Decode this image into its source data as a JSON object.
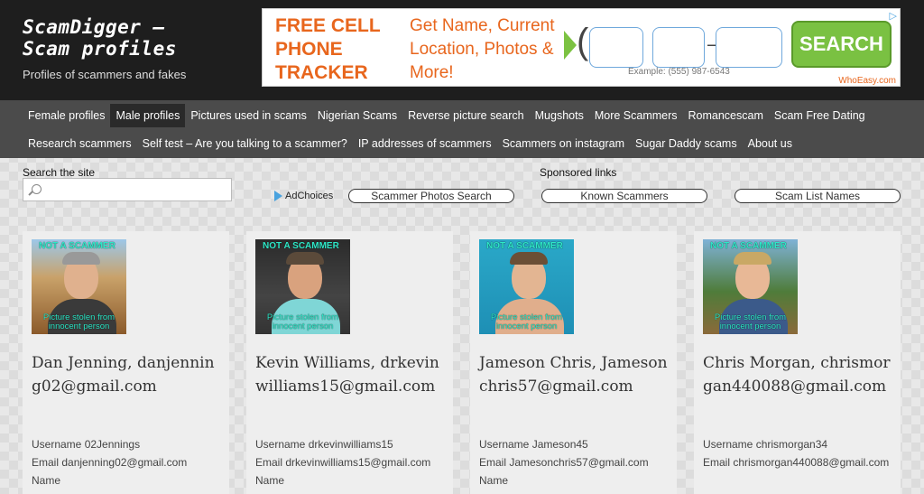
{
  "site": {
    "title": "ScamDigger – Scam profiles",
    "tagline": "Profiles of scammers and fakes"
  },
  "ad": {
    "headline": "FREE CELL PHONE TRACKER",
    "copy": "Get Name, Current Location, Photos & More!",
    "example": "Example: (555) 987-6543",
    "search_label": "SEARCH",
    "brand": "WhoEasy.com",
    "colors": {
      "orange": "#e8661d",
      "green": "#7ac142"
    }
  },
  "nav": {
    "row1": [
      "Female profiles",
      "Male profiles",
      "Pictures used in scams",
      "Nigerian Scams",
      "Reverse picture search",
      "Mugshots",
      "More Scammers",
      "Romancescam",
      "Scam Free Dating"
    ],
    "row2": [
      "Research scammers",
      "Self test – Are you talking to a scammer?",
      "IP addresses of scammers",
      "Scammers on instagram",
      "Sugar Daddy scams",
      "About us"
    ],
    "active": "Male profiles"
  },
  "search": {
    "label": "Search the site",
    "placeholder": ""
  },
  "sponsored": {
    "label": "Sponsored links",
    "adchoices": "AdChoices",
    "links": [
      "Scammer Photos Search",
      "Known Scammers",
      "Scam List Names"
    ]
  },
  "profiles": [
    {
      "name": "Dan Jenning,",
      "email_title": "danjenning02@gmail.com",
      "username": "Username 02Jennings",
      "email": "Email danjenning02@gmail.com",
      "name_label": "Name",
      "stamp_top": "NOT A SCAMMER",
      "stamp_bottom": "Picture stolen from innocent person"
    },
    {
      "name": "Kevin Williams,",
      "email_title": "drkevinwilliams15@gmail.com",
      "username": "Username drkevinwilliams15",
      "email": "Email drkevinwilliams15@gmail.com",
      "name_label": "Name",
      "stamp_top": "NOT A SCAMMER",
      "stamp_bottom": "Picture stolen from innocent person"
    },
    {
      "name": "Jameson Chris,",
      "email_title": "Jamesonchris57@gmail.com",
      "username": "Username Jameson45",
      "email": "Email Jamesonchris57@gmail.com",
      "name_label": "Name",
      "stamp_top": "NOT A SCAMMER",
      "stamp_bottom": "Picture stolen from innocent person"
    },
    {
      "name": "Chris Morgan,",
      "email_title": "chrismorgan440088@gmail.com",
      "username": "Username chrismorgan34",
      "email": "Email chrismorgan440088@gmail.com",
      "name_label": "",
      "stamp_top": "NOT A SCAMMER",
      "stamp_bottom": "Picture stolen from innocent person"
    }
  ]
}
